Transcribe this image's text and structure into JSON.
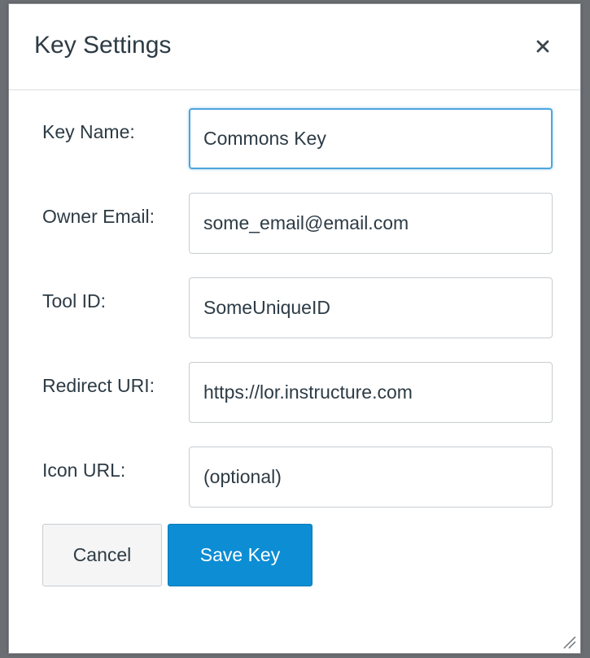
{
  "dialog": {
    "title": "Key Settings",
    "close_icon": "close-icon"
  },
  "form": {
    "fields": [
      {
        "label": "Key Name:",
        "value": "Commons Key",
        "placeholder": ""
      },
      {
        "label": "Owner Email:",
        "value": "some_email@email.com",
        "placeholder": ""
      },
      {
        "label": "Tool ID:",
        "value": "SomeUniqueID",
        "placeholder": ""
      },
      {
        "label": "Redirect URI:",
        "value": "https://lor.instructure.com",
        "placeholder": ""
      },
      {
        "label": "Icon URL:",
        "value": "",
        "placeholder": "(optional)"
      }
    ]
  },
  "buttons": {
    "cancel_label": "Cancel",
    "save_label": "Save Key"
  },
  "colors": {
    "primary": "#0c8dd4",
    "focus_border": "#4ea6dd",
    "text": "#2d3b45"
  }
}
